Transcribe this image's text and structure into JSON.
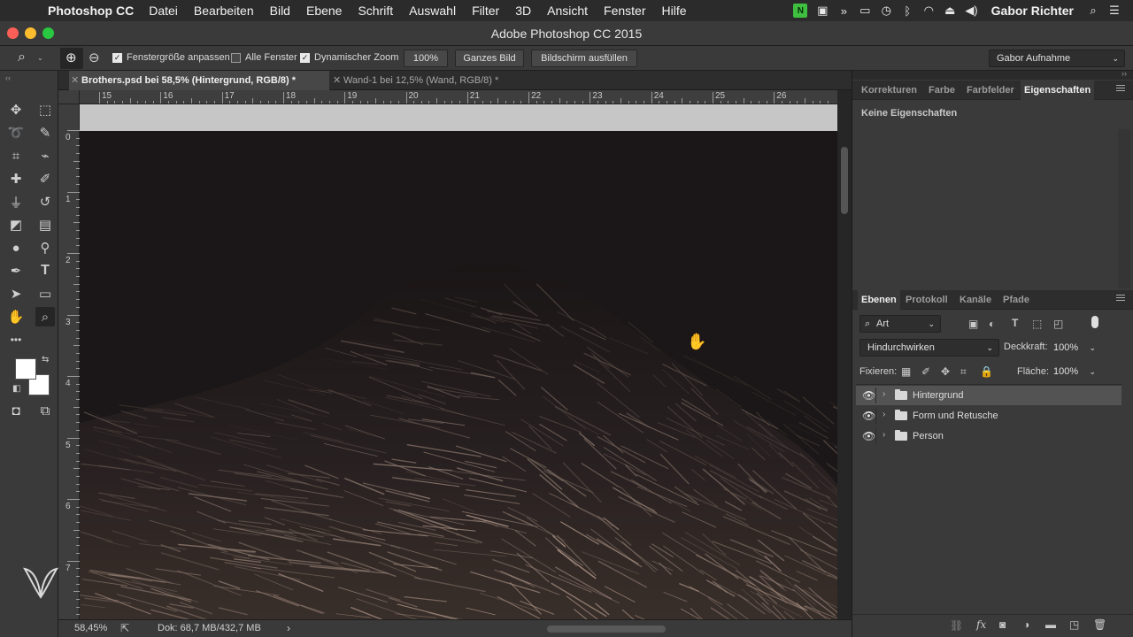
{
  "menubar": {
    "apple_glyph": "",
    "app_name": "Photoshop CC",
    "items": [
      "Datei",
      "Bearbeiten",
      "Bild",
      "Ebene",
      "Schrift",
      "Auswahl",
      "Filter",
      "3D",
      "Ansicht",
      "Fenster",
      "Hilfe"
    ],
    "user": "Gabor Richter"
  },
  "window": {
    "title": "Adobe Photoshop CC 2015"
  },
  "options": {
    "fit_window_label": "Fenstergröße anpassen",
    "fit_window_checked": true,
    "all_windows_label": "Alle Fenster",
    "all_windows_checked": false,
    "dynamic_zoom_label": "Dynamischer Zoom",
    "dynamic_zoom_checked": true,
    "zoom_100_label": "100%",
    "whole_image_label": "Ganzes Bild",
    "fill_screen_label": "Bildschirm ausfüllen",
    "workspace_value": "Gabor Aufnahme"
  },
  "tabs": [
    {
      "label": "Brothers.psd bei 58,5% (Hintergrund, RGB/8) *",
      "active": true
    },
    {
      "label": "Wand-1 bei 12,5% (Wand, RGB/8) *",
      "active": false
    }
  ],
  "ruler": {
    "h_ticks": [
      "15",
      "16",
      "17",
      "18",
      "19",
      "20",
      "21",
      "22",
      "23",
      "24",
      "25",
      "26"
    ],
    "v_ticks": [
      "0",
      "1",
      "2",
      "3",
      "4",
      "5",
      "6",
      "7"
    ]
  },
  "status": {
    "zoom": "58,45%",
    "doc_size": "Dok: 68,7 MB/432,7 MB",
    "arrow": "›"
  },
  "properties_panel": {
    "tabs": [
      "Korrekturen",
      "Farbe",
      "Farbfelder",
      "Eigenschaften"
    ],
    "active_tab": "Eigenschaften",
    "empty_text": "Keine Eigenschaften"
  },
  "layers_panel": {
    "tabs": [
      "Ebenen",
      "Protokoll",
      "Kanäle",
      "Pfade"
    ],
    "active_tab": "Ebenen",
    "filter_value": "Art",
    "blend_mode": "Hindurchwirken",
    "opacity_label": "Deckkraft:",
    "opacity_value": "100%",
    "lock_label": "Fixieren:",
    "fill_label": "Fläche:",
    "fill_value": "100%",
    "layers": [
      {
        "name": "Hintergrund",
        "type": "group",
        "visible": true,
        "selected": true
      },
      {
        "name": "Form und Retusche",
        "type": "group",
        "visible": true,
        "selected": false
      },
      {
        "name": "Person",
        "type": "group",
        "visible": true,
        "selected": false
      }
    ]
  },
  "colors": {
    "menubar_bg": "#2b2b2b",
    "panel_bg": "#3a3a3a",
    "canvas_image": "#1b1617",
    "traffic_close": "#fc5f57",
    "traffic_min": "#fdbc2e",
    "traffic_max": "#28c840"
  }
}
